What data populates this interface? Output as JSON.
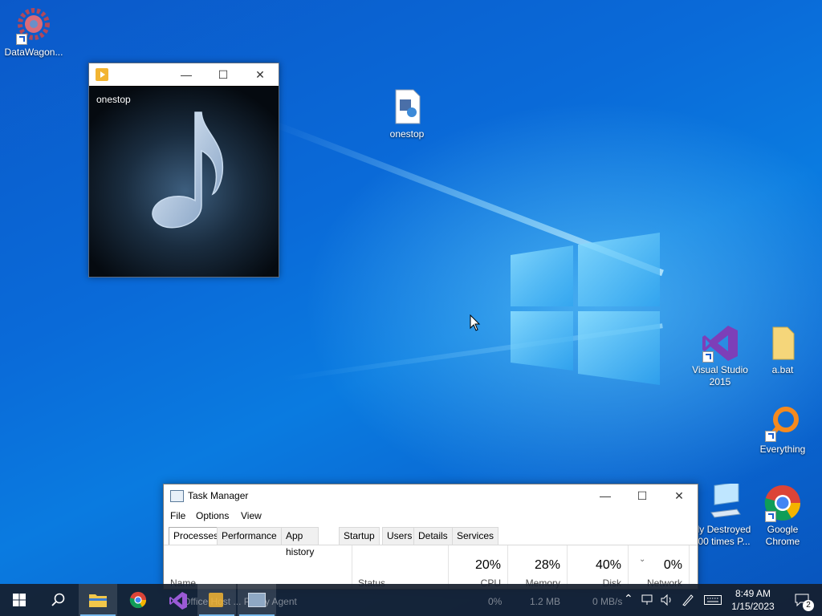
{
  "desktop": {
    "icons": {
      "datawagon": "DataWagon...",
      "onestop_file": "onestop",
      "visual_studio_line1": "Visual Studio",
      "visual_studio_line2": "2015",
      "abat": "a.bat",
      "everything": "Everything",
      "destroyed_line1": "ly Destroyed",
      "destroyed_line2": "00 times P...",
      "chrome_line1": "Google",
      "chrome_line2": "Chrome"
    }
  },
  "media_window": {
    "label": "onestop",
    "minimize_glyph": "—",
    "maximize_glyph": "☐",
    "close_glyph": "✕"
  },
  "task_manager": {
    "title": "Task Manager",
    "menu": {
      "file": "File",
      "options": "Options",
      "view": "View"
    },
    "tabs": [
      "Processes",
      "Performance",
      "App history",
      "Startup",
      "Users",
      "Details",
      "Services"
    ],
    "columns": {
      "name": "Name",
      "status": "Status",
      "cpu_pct": "20%",
      "cpu": "CPU",
      "memory_pct": "28%",
      "memory": "Memory",
      "disk_pct": "40%",
      "disk": "Disk",
      "network_pct": "0%",
      "network": "Network"
    },
    "partial_row": {
      "name": "Office Host ... Policy Agent",
      "cpu": "0%",
      "memory": "1.2 MB",
      "disk": "0 MB/s"
    }
  },
  "taskbar": {
    "time": "8:49 AM",
    "date": "1/15/2023",
    "notification_count": "2"
  }
}
